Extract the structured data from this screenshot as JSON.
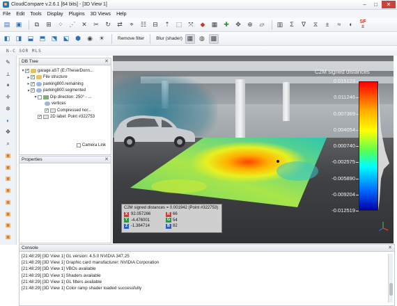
{
  "window": {
    "title": "CloudCompare v.2.6.1 [64 bits] - [3D View 1]",
    "controls": [
      "–",
      "□",
      "✕"
    ]
  },
  "menu": [
    "File",
    "Edit",
    "Tools",
    "Display",
    "Plugins",
    "3D Views",
    "Help"
  ],
  "toolbar2": {
    "remove_filter": "Remove filter",
    "blur_shader": "Blur (shader)"
  },
  "toolbar3": {
    "mini_labels": "N-C SOR MLS"
  },
  "db_tree": {
    "title": "DB Tree",
    "items": [
      "garage.aST (E:/These/Donn...",
      "File structure",
      "parking800.remaining",
      "parking800.segmented",
      "Dip direction: 250° - ...",
      "vertices",
      "Compressed nor...",
      "2D label: Point #322753"
    ],
    "camera_link": "Camera Link"
  },
  "properties": {
    "title": "Properties"
  },
  "view3d": {
    "scale_title": "C2M signed distances",
    "scale_ticks": [
      "0.015123",
      "0.011246",
      "0.007369",
      "0.004054",
      "0.000740",
      "-0.002575",
      "-0.005890",
      "-0.009204",
      "-0.012519"
    ],
    "scale_colors": [
      "#ff0000",
      "#ffaa00",
      "#ffff00",
      "#55ff55",
      "#00ffff",
      "#0066ff",
      "#0000aa"
    ],
    "info_box": {
      "title": "C2M signed distances = 0.001942 (Point #322753)",
      "rows": [
        {
          "axis": "X",
          "value": "92.057266",
          "channel": "R",
          "channel_value": "66",
          "axis_color": "#d23b3b",
          "channel_color": "#d23b3b"
        },
        {
          "axis": "Y",
          "value": "-4.476001",
          "channel": "G",
          "channel_value": "54",
          "axis_color": "#2e9a3e",
          "channel_color": "#2e9a3e"
        },
        {
          "axis": "Z",
          "value": "-1.384714",
          "channel": "B",
          "channel_value": "82",
          "axis_color": "#2f5fb8",
          "channel_color": "#2f5fb8"
        }
      ]
    }
  },
  "console": {
    "title": "Console",
    "lines": [
      "[21:48:29] [3D View 1] GL version: 4.5.0 NVIDIA 347.25",
      "[21:48:29] [3D View 1] Graphic card manufacturer: NVIDIA Corporation",
      "[21:48:29] [3D View 1] VBOs available",
      "[21:48:29] [3D View 1] Shaders available",
      "[21:48:29] [3D View 1] GL filters available",
      "[21:48:29] [3D View 1] Color ramp shader loaded successfully"
    ]
  }
}
